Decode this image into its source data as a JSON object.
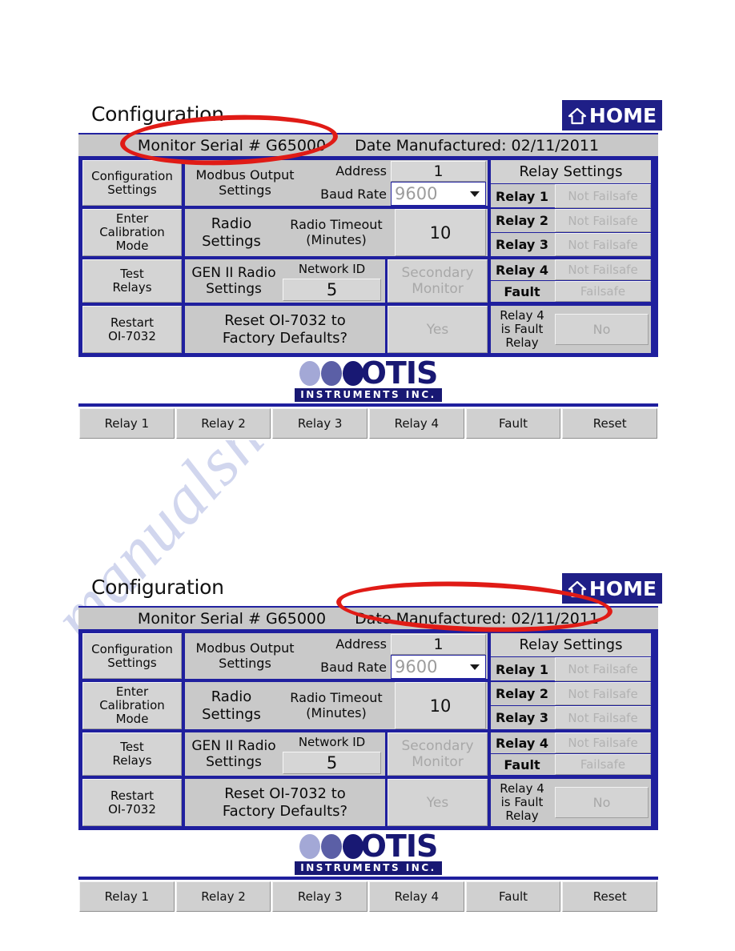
{
  "screen": {
    "title": "Configuration",
    "home_label": "HOME",
    "home_icon": "house-icon",
    "serial_label": "Monitor Serial # G65000",
    "date_label": "Date Manufactured: 02/11/2011"
  },
  "left_buttons": [
    {
      "line1": "Configuration",
      "line2": "Settings",
      "line3": ""
    },
    {
      "line1": "Enter",
      "line2": "Calibration",
      "line3": "Mode"
    },
    {
      "line1": "Test",
      "line2": "Relays",
      "line3": ""
    },
    {
      "line1": "Restart",
      "line2": "OI-7032",
      "line3": ""
    }
  ],
  "modbus": {
    "label_line1": "Modbus Output",
    "label_line2": "Settings",
    "address_label": "Address",
    "address_value": "1",
    "baud_label": "Baud Rate",
    "baud_value": "9600",
    "baud_arrow_icon": "chevron-down-icon"
  },
  "radio": {
    "label_line1": "Radio",
    "label_line2": "Settings",
    "timeout_label_line1": "Radio Timeout",
    "timeout_label_line2": "(Minutes)",
    "timeout_value": "10"
  },
  "gen2": {
    "label_line1": "GEN II Radio",
    "label_line2": "Settings",
    "network_label": "Network ID",
    "network_value": "5",
    "secondary_line1": "Secondary",
    "secondary_line2": "Monitor"
  },
  "factory_reset": {
    "prompt_line1": "Reset OI-7032 to",
    "prompt_line2": "Factory Defaults?",
    "confirm_label": "Yes"
  },
  "relay_settings": {
    "header": "Relay Settings",
    "rows": [
      {
        "name": "Relay 1",
        "value": "Not Failsafe"
      },
      {
        "name": "Relay 2",
        "value": "Not Failsafe"
      },
      {
        "name": "Relay 3",
        "value": "Not Failsafe"
      },
      {
        "name": "Relay 4",
        "value": "Not Failsafe"
      },
      {
        "name": "Fault",
        "value": "Failsafe"
      }
    ],
    "footer": {
      "label_line1": "Relay 4",
      "label_line2": "is Fault",
      "label_line3": "Relay",
      "value": "No"
    }
  },
  "logo": {
    "word": "OTIS",
    "subtitle": "INSTRUMENTS INC."
  },
  "bottom_bar": {
    "buttons": [
      "Relay 1",
      "Relay 2",
      "Relay 3",
      "Relay 4",
      "Fault",
      "Reset"
    ]
  },
  "annotations": {
    "ellipse_1_target": "Monitor Serial # G65000",
    "ellipse_2_target": "Date Manufactured: 02/11/2011",
    "color": "#e01b16"
  },
  "watermark": {
    "text": "manualshive.com"
  }
}
